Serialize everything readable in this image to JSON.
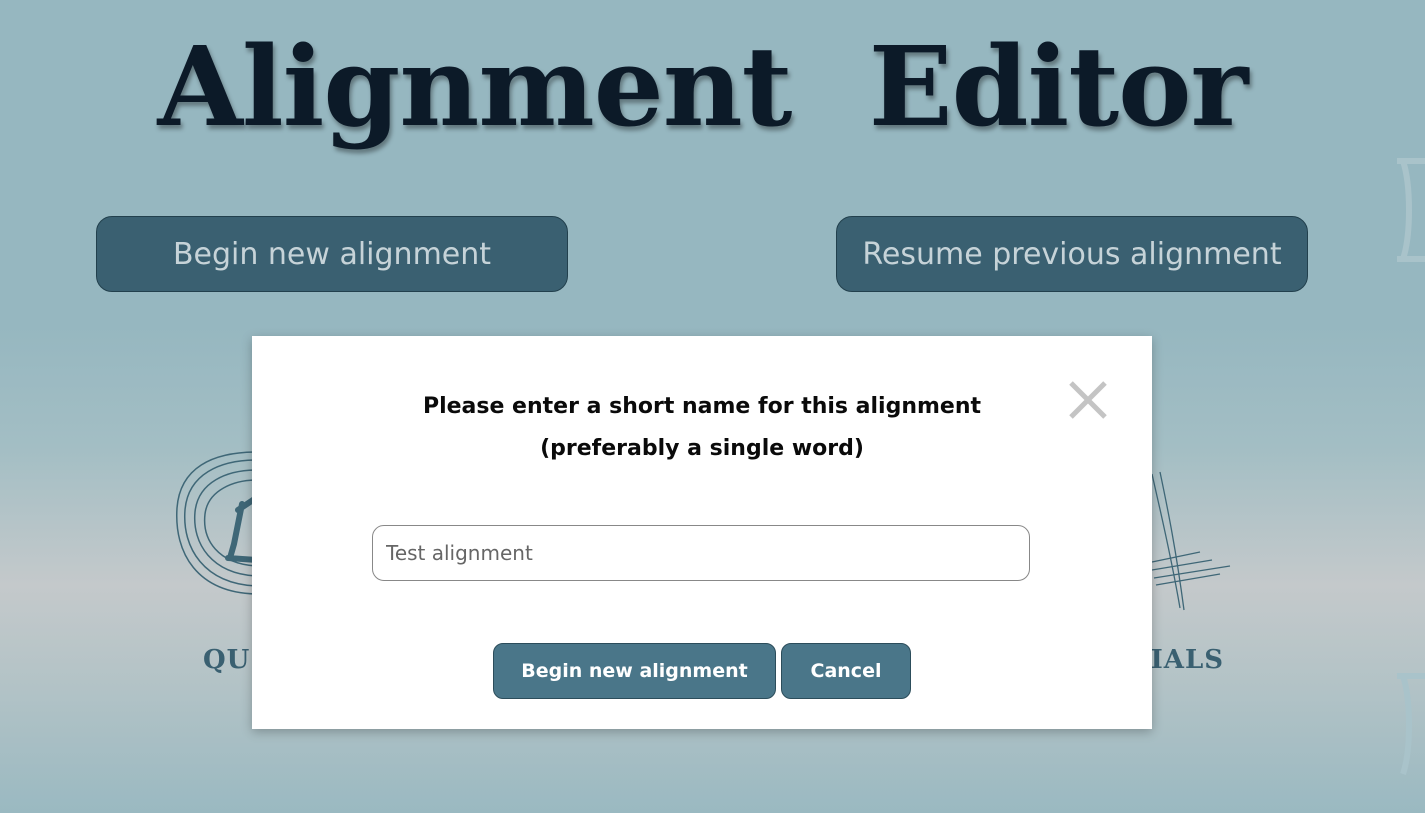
{
  "page": {
    "title": "Alignment Editor"
  },
  "top_buttons": {
    "begin_label": "Begin new alignment",
    "resume_label": "Resume previous alignment"
  },
  "background_links": {
    "left_label": "QU",
    "right_label": "RIALS"
  },
  "modal": {
    "title_line1": "Please enter a short name for this alignment",
    "title_line2": "(preferably a single word)",
    "input_value": "Test alignment",
    "begin_label": "Begin new alignment",
    "cancel_label": "Cancel",
    "close_icon": "close-icon"
  },
  "colors": {
    "button_bg": "#3a6071",
    "modal_button_bg": "#4a7689",
    "title_color": "#0c1a28"
  }
}
